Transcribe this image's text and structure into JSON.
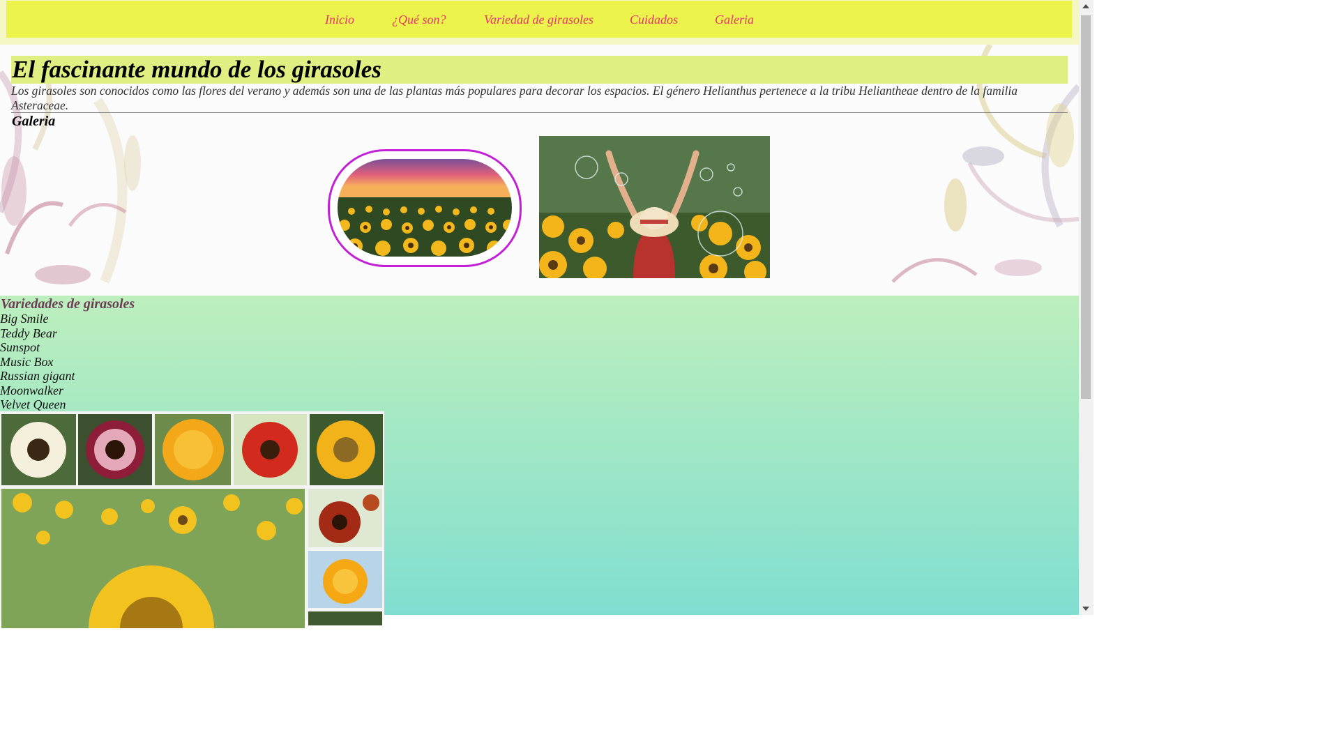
{
  "nav": {
    "items": [
      "Inicio",
      "¿Qué son?",
      "Variedad de girasoles",
      "Cuidados",
      "Galeria"
    ]
  },
  "hero": {
    "title": "El fascinante mundo de los girasoles",
    "intro": "Los girasoles son conocidos como las flores del verano y además son una de las plantas más populares para decorar los espacios. El género Helianthus pertenece a la tribu Heliantheae dentro de la familia Asteraceae.",
    "gallery_heading": "Galeria"
  },
  "varieties": {
    "heading": "Variedades de girasoles",
    "items": [
      "Big Smile",
      "Teddy Bear",
      "Sunspot",
      "Music Box",
      "Russian gigant",
      "Moonwalker",
      "Velvet Queen"
    ]
  },
  "colors": {
    "nav_bg": "#ecf34a",
    "nav_link": "#e8356a",
    "title_band": "#e1ee82",
    "pill_border": "#c21fd6",
    "varieties_gradient_top": "#bdefbd",
    "varieties_gradient_bottom": "#80ded0"
  }
}
